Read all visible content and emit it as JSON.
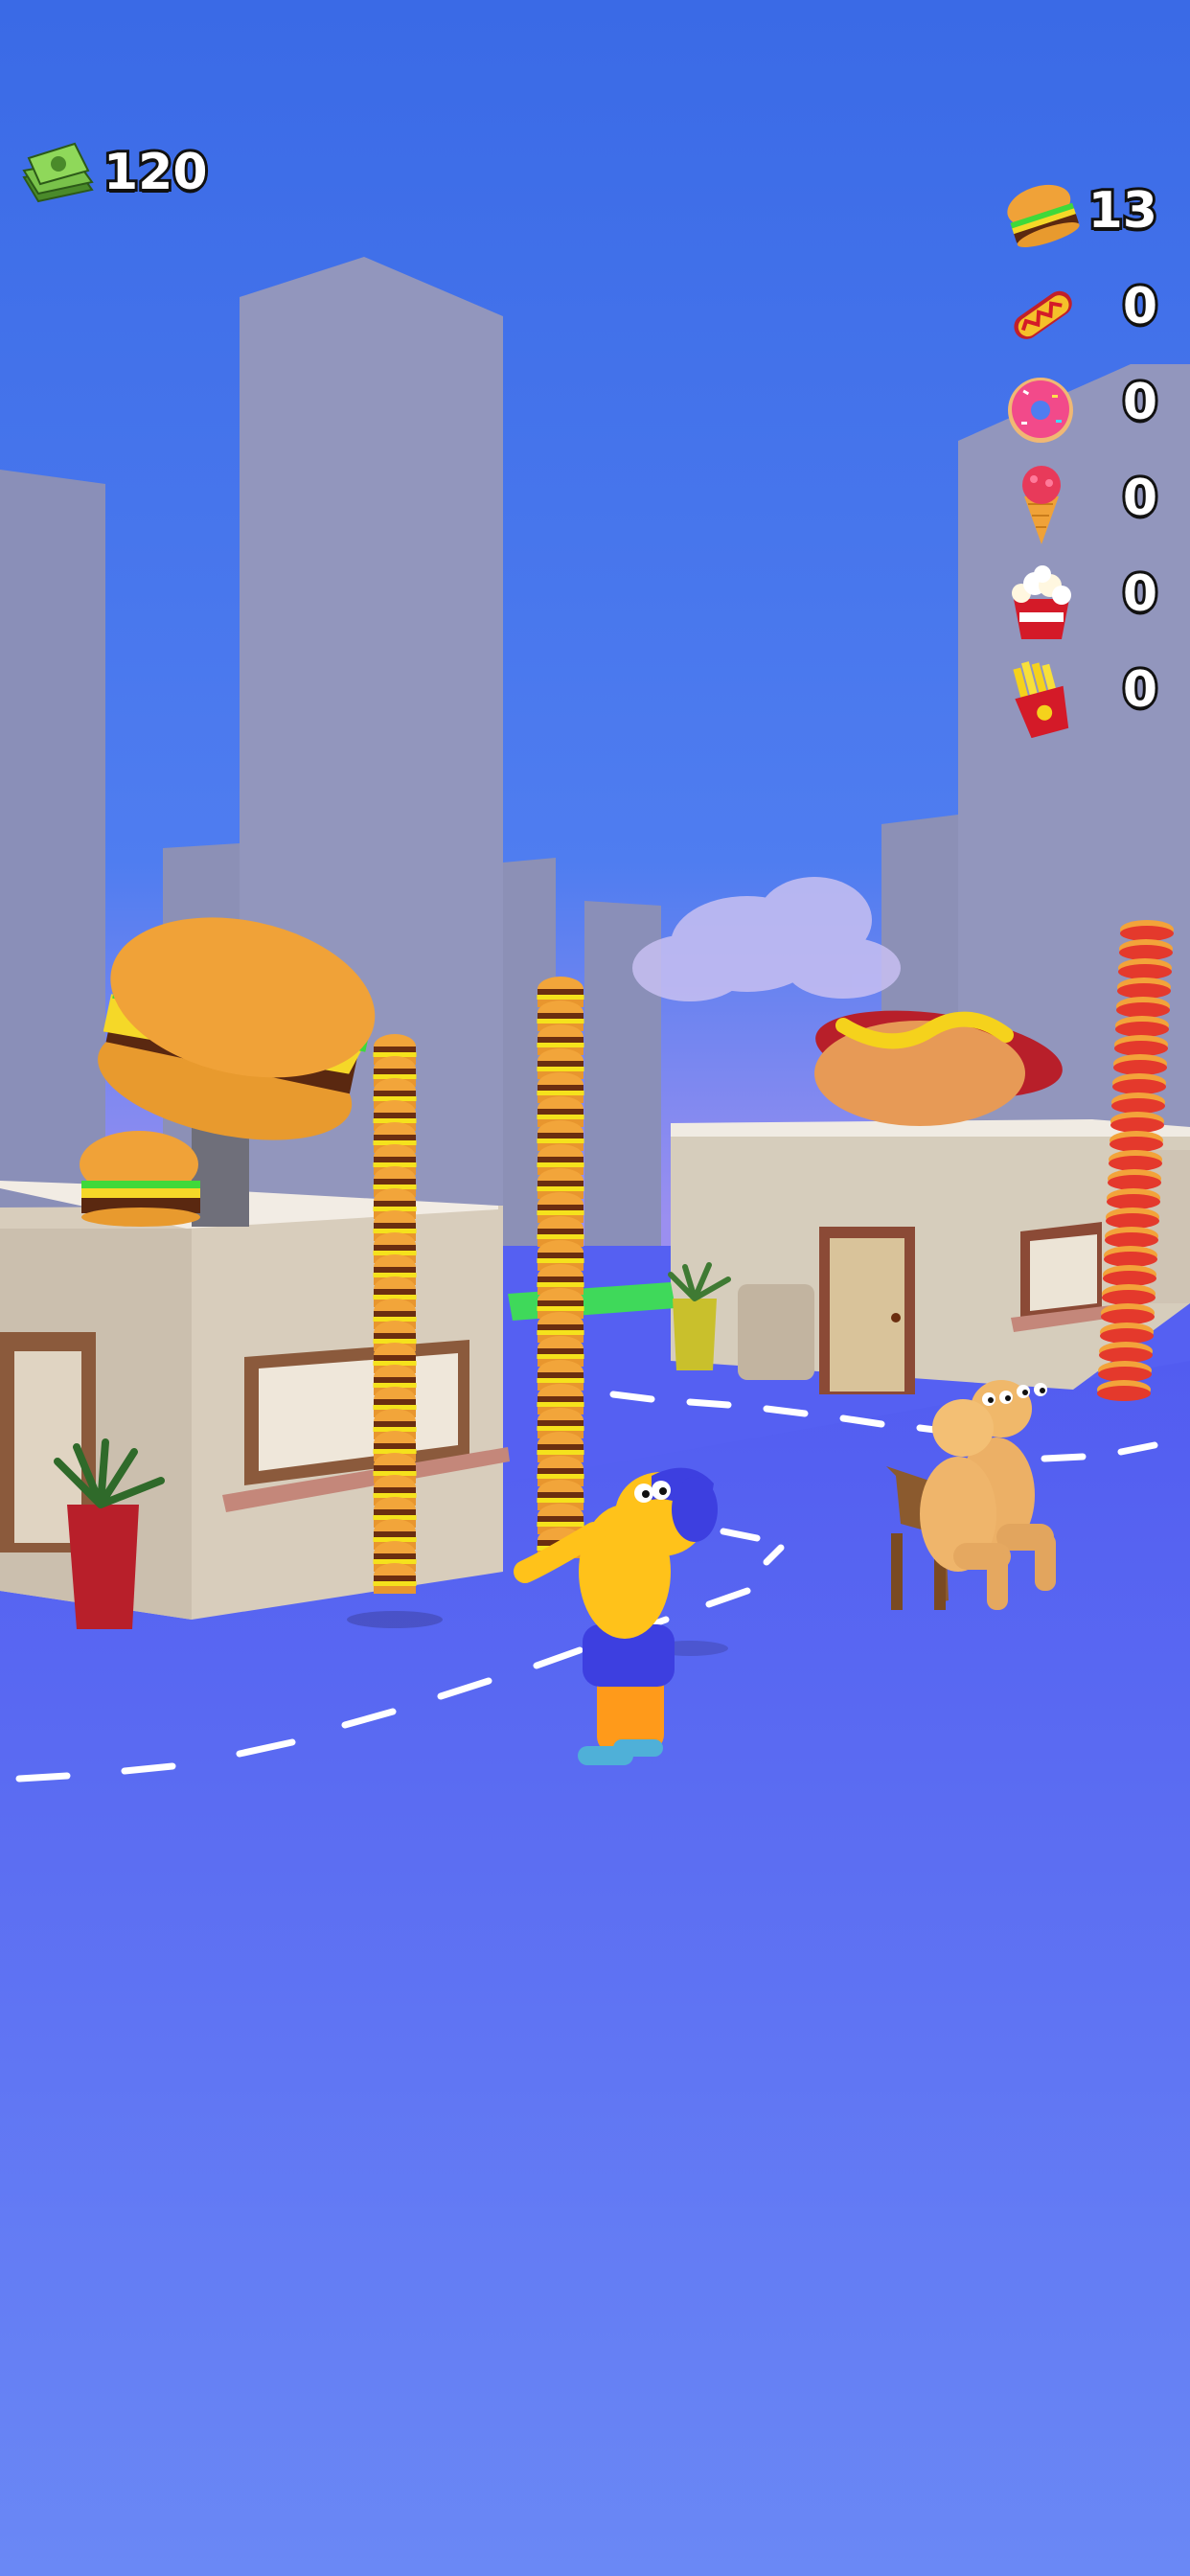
{
  "hud": {
    "money": "120",
    "money_icon": "cash-stack-icon"
  },
  "inventory": [
    {
      "icon": "burger-icon",
      "count": "13"
    },
    {
      "icon": "hotdog-icon",
      "count": "0"
    },
    {
      "icon": "donut-icon",
      "count": "0"
    },
    {
      "icon": "ice-cream-icon",
      "count": "0"
    },
    {
      "icon": "popcorn-icon",
      "count": "0"
    },
    {
      "icon": "fries-icon",
      "count": "0"
    }
  ],
  "colors": {
    "sky_top": "#3f6fe8",
    "sky_bottom": "#6a8ff0",
    "ground": "#5a63f5",
    "building": "#8f93b8",
    "player_body": "#ffc21a",
    "player_cap": "#3d3fe0"
  }
}
